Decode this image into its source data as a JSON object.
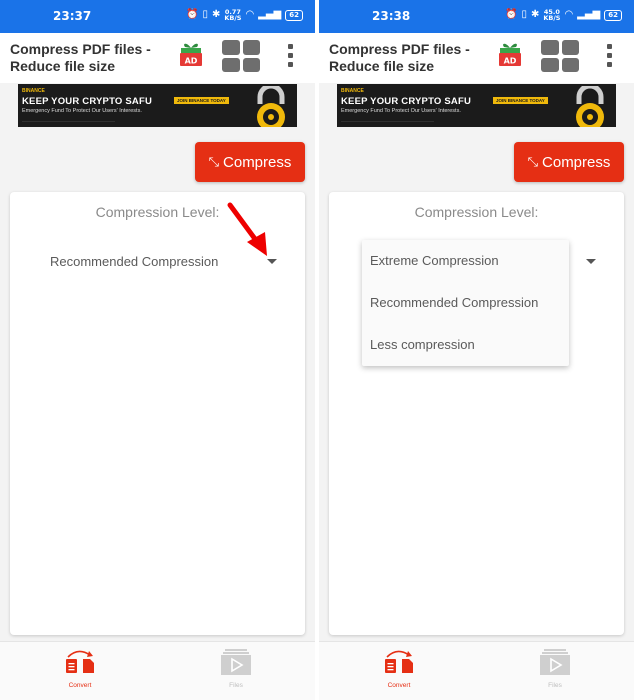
{
  "screens": [
    {
      "status_bar": {
        "time": "23:37",
        "net_speed_value": "0.77",
        "net_speed_unit": "KB/S",
        "battery": "62"
      },
      "app_bar": {
        "title": "Compress PDF files - Reduce file size",
        "ad_badge": "AD"
      },
      "ad_banner": {
        "brand": "BINANCE",
        "headline": "KEEP YOUR CRYPTO SAFU",
        "cta": "JOIN BINANCE TODAY",
        "subtext": "Emergency Fund To Protect Our Users' Interests."
      },
      "compress_button": {
        "label": "Compress",
        "icon": "compress-arrows-icon"
      },
      "compression_card": {
        "label": "Compression Level:",
        "selected_value": "Recommended Compression",
        "dropdown_open": false
      },
      "bottom_nav": {
        "convert_label": "Convert",
        "files_label": "Files"
      }
    },
    {
      "status_bar": {
        "time": "23:38",
        "net_speed_value": "45.0",
        "net_speed_unit": "KB/S",
        "battery": "62"
      },
      "app_bar": {
        "title": "Compress PDF files - Reduce file size",
        "ad_badge": "AD"
      },
      "ad_banner": {
        "brand": "BINANCE",
        "headline": "KEEP YOUR CRYPTO SAFU",
        "cta": "JOIN BINANCE TODAY",
        "subtext": "Emergency Fund To Protect Our Users' Interests."
      },
      "compress_button": {
        "label": "Compress",
        "icon": "compress-arrows-icon"
      },
      "compression_card": {
        "label": "Compression Level:",
        "dropdown_open": true,
        "options": [
          "Extreme Compression",
          "Recommended Compression",
          "Less compression"
        ]
      },
      "bottom_nav": {
        "convert_label": "Convert",
        "files_label": "Files"
      }
    }
  ],
  "colors": {
    "status_bar": "#1a73e8",
    "accent_red": "#e52f14",
    "banner_bg": "#1b1b1b",
    "banner_yellow": "#f0b90b"
  }
}
